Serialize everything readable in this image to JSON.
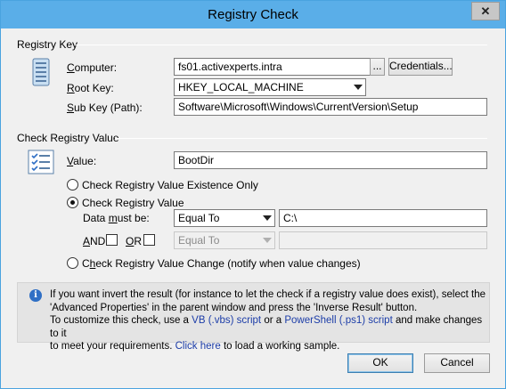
{
  "window": {
    "title": "Registry Check",
    "close_glyph": "✕"
  },
  "registry_key": {
    "group_label": "Registry Key",
    "computer_label": "Computer:",
    "computer_value": "fs01.activexperts.intra",
    "browse_label": "...",
    "credentials_label": "Credentials...",
    "root_key_label": "Root Key:",
    "root_key_value": "HKEY_LOCAL_MACHINE",
    "sub_key_label": "Sub Key (Path):",
    "sub_key_value": "Software\\Microsoft\\Windows\\CurrentVersion\\Setup"
  },
  "check_value": {
    "group_label": "Check Registry Value",
    "value_label": "Value:",
    "value_value": "BootDir",
    "radio_existence": "Check Registry Value Existence Only",
    "radio_value": "Check Registry Value",
    "data_must_be_label": "Data must be:",
    "operator": "Equal To",
    "data_value": "C:\\",
    "and_label": "AND",
    "or_label": "OR",
    "operator2": "Equal To",
    "radio_change": "Check Registry Value Change (notify when value changes)"
  },
  "info": {
    "line1": "If you want invert the result (for instance to let the check if a registry value does exist), select the",
    "line2": "'Advanced Properties' in the parent window and press the 'Inverse Result' button.",
    "line3a": "To customize this check, use a ",
    "vbs_link": "VB (.vbs) script",
    "line3b": " or a ",
    "ps_link": "PowerShell (.ps1) script",
    "line3c": " and make changes to it",
    "line4a": "to meet your requirements. ",
    "click_here": "Click here",
    "line4b": " to load a working sample."
  },
  "footer": {
    "ok_label": "OK",
    "cancel_label": "Cancel"
  },
  "icons": {
    "registry": "server-icon",
    "list": "checklist-icon",
    "info": "info-icon"
  }
}
